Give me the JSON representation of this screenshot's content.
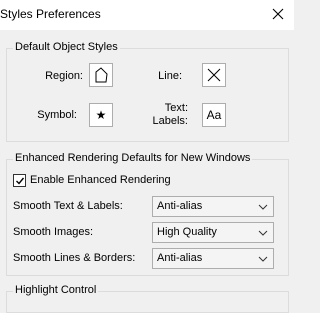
{
  "window": {
    "title": "Styles Preferences"
  },
  "default_object_styles": {
    "legend": "Default Object Styles",
    "region_label": "Region:",
    "line_label": "Line:",
    "symbol_label": "Symbol:",
    "text_labels_line1": "Text:",
    "text_labels_line2": "Labels:",
    "text_button_glyph": "Aa"
  },
  "enhanced_rendering": {
    "legend": "Enhanced Rendering Defaults for New Windows",
    "enable_label": "Enable Enhanced Rendering",
    "enable_checked": true,
    "smooth_text_label": "Smooth Text & Labels:",
    "smooth_text_value": "Anti-alias",
    "smooth_images_label": "Smooth Images:",
    "smooth_images_value": "High Quality",
    "smooth_lines_label": "Smooth Lines & Borders:",
    "smooth_lines_value": "Anti-alias"
  },
  "highlight_control": {
    "legend": "Highlight Control"
  }
}
